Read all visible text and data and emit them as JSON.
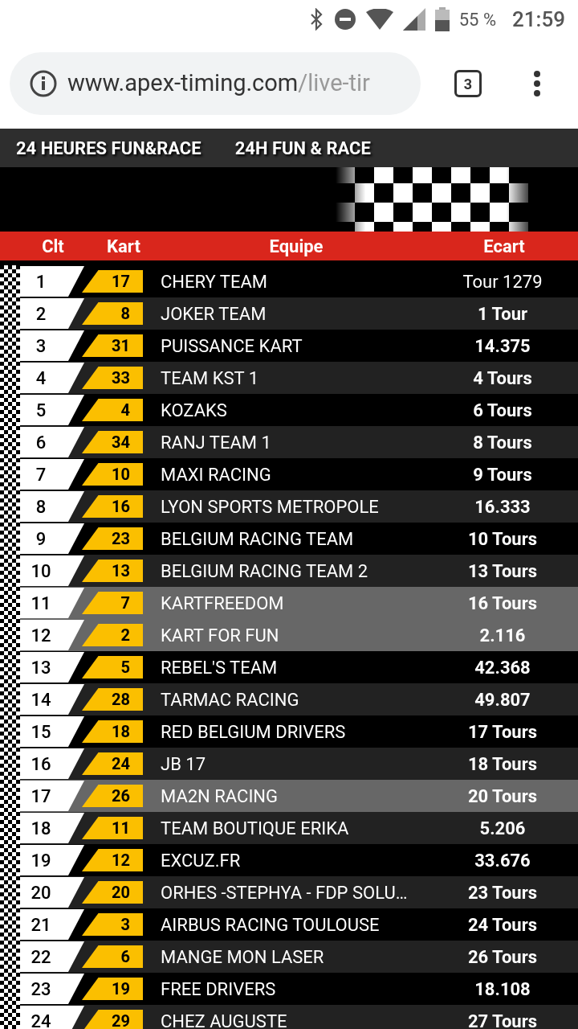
{
  "status_bar": {
    "battery": "55 %",
    "time": "21:59"
  },
  "browser": {
    "url_host": "www.apex-timing.com",
    "url_path": "/live-tir",
    "tab_count": "3"
  },
  "title_bar": [
    "24 HEURES FUN&RACE",
    "24H FUN & RACE"
  ],
  "table": {
    "columns": [
      "Clt",
      "Kart",
      "Equipe",
      "Ecart"
    ],
    "rows": [
      {
        "clt": "1",
        "kart": "17",
        "team": "CHERY TEAM",
        "gap": "Tour 1279",
        "leader": true,
        "highlighted": false
      },
      {
        "clt": "2",
        "kart": "8",
        "team": "JOKER TEAM",
        "gap": "1 Tour",
        "leader": false,
        "highlighted": false
      },
      {
        "clt": "3",
        "kart": "31",
        "team": "PUISSANCE KART",
        "gap": "14.375",
        "leader": false,
        "highlighted": false
      },
      {
        "clt": "4",
        "kart": "33",
        "team": "TEAM KST 1",
        "gap": "4 Tours",
        "leader": false,
        "highlighted": false
      },
      {
        "clt": "5",
        "kart": "4",
        "team": "KOZAKS",
        "gap": "6 Tours",
        "leader": false,
        "highlighted": false
      },
      {
        "clt": "6",
        "kart": "34",
        "team": "RANJ TEAM 1",
        "gap": "8 Tours",
        "leader": false,
        "highlighted": false
      },
      {
        "clt": "7",
        "kart": "10",
        "team": "MAXI RACING",
        "gap": "9 Tours",
        "leader": false,
        "highlighted": false
      },
      {
        "clt": "8",
        "kart": "16",
        "team": "LYON SPORTS METROPOLE",
        "gap": "16.333",
        "leader": false,
        "highlighted": false
      },
      {
        "clt": "9",
        "kart": "23",
        "team": "BELGIUM RACING TEAM",
        "gap": "10 Tours",
        "leader": false,
        "highlighted": false
      },
      {
        "clt": "10",
        "kart": "13",
        "team": "BELGIUM RACING TEAM 2",
        "gap": "13 Tours",
        "leader": false,
        "highlighted": false
      },
      {
        "clt": "11",
        "kart": "7",
        "team": "KARTFREEDOM",
        "gap": "16 Tours",
        "leader": false,
        "highlighted": true
      },
      {
        "clt": "12",
        "kart": "2",
        "team": "KART FOR FUN",
        "gap": "2.116",
        "leader": false,
        "highlighted": true
      },
      {
        "clt": "13",
        "kart": "5",
        "team": "REBEL'S TEAM",
        "gap": "42.368",
        "leader": false,
        "highlighted": false
      },
      {
        "clt": "14",
        "kart": "28",
        "team": "TARMAC RACING",
        "gap": "49.807",
        "leader": false,
        "highlighted": false
      },
      {
        "clt": "15",
        "kart": "18",
        "team": "RED BELGIUM DRIVERS",
        "gap": "17 Tours",
        "leader": false,
        "highlighted": false
      },
      {
        "clt": "16",
        "kart": "24",
        "team": "JB 17",
        "gap": "18 Tours",
        "leader": false,
        "highlighted": false
      },
      {
        "clt": "17",
        "kart": "26",
        "team": "MA2N RACING",
        "gap": "20 Tours",
        "leader": false,
        "highlighted": true
      },
      {
        "clt": "18",
        "kart": "11",
        "team": "TEAM BOUTIQUE ERIKA",
        "gap": "5.206",
        "leader": false,
        "highlighted": false
      },
      {
        "clt": "19",
        "kart": "12",
        "team": "EXCUZ.FR",
        "gap": "33.676",
        "leader": false,
        "highlighted": false
      },
      {
        "clt": "20",
        "kart": "20",
        "team": "ORHES -STEPHYA - FDP SOLU…",
        "gap": "23 Tours",
        "leader": false,
        "highlighted": false
      },
      {
        "clt": "21",
        "kart": "3",
        "team": "AIRBUS RACING TOULOUSE",
        "gap": "24 Tours",
        "leader": false,
        "highlighted": false
      },
      {
        "clt": "22",
        "kart": "6",
        "team": "MANGE MON LASER",
        "gap": "26 Tours",
        "leader": false,
        "highlighted": false
      },
      {
        "clt": "23",
        "kart": "19",
        "team": "FREE DRIVERS",
        "gap": "18.108",
        "leader": false,
        "highlighted": false
      },
      {
        "clt": "24",
        "kart": "29",
        "team": "CHEZ AUGUSTE",
        "gap": "27 Tours",
        "leader": false,
        "highlighted": false
      }
    ]
  }
}
